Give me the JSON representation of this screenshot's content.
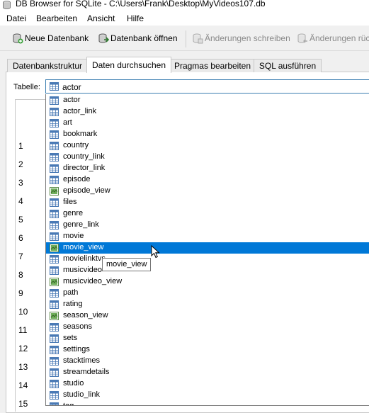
{
  "window": {
    "title": "DB Browser for SQLite - C:\\Users\\Frank\\Desktop\\MyVideos107.db"
  },
  "menu": [
    "Datei",
    "Bearbeiten",
    "Ansicht",
    "Hilfe"
  ],
  "toolbar": {
    "new_db": "Neue Datenbank",
    "open_db": "Datenbank öffnen",
    "write_changes": "Änderungen schreiben",
    "revert_changes": "Änderungen rück"
  },
  "tabs": [
    "Datenbankstruktur",
    "Daten durchsuchen",
    "Pragmas bearbeiten",
    "SQL ausführen"
  ],
  "active_tab": "Daten durchsuchen",
  "table_selector": {
    "label": "Tabelle:",
    "value": "actor"
  },
  "row_numbers": [
    "1",
    "2",
    "3",
    "4",
    "5",
    "6",
    "7",
    "8",
    "9",
    "10",
    "11",
    "12",
    "13",
    "14",
    "15"
  ],
  "dropdown": {
    "items": [
      {
        "name": "actor",
        "icon": "table-icon"
      },
      {
        "name": "actor_link",
        "icon": "table-icon"
      },
      {
        "name": "art",
        "icon": "table-icon"
      },
      {
        "name": "bookmark",
        "icon": "table-icon"
      },
      {
        "name": "country",
        "icon": "table-icon"
      },
      {
        "name": "country_link",
        "icon": "table-icon"
      },
      {
        "name": "director_link",
        "icon": "table-icon"
      },
      {
        "name": "episode",
        "icon": "table-icon"
      },
      {
        "name": "episode_view",
        "icon": "view-icon"
      },
      {
        "name": "files",
        "icon": "table-icon"
      },
      {
        "name": "genre",
        "icon": "table-icon"
      },
      {
        "name": "genre_link",
        "icon": "table-icon"
      },
      {
        "name": "movie",
        "icon": "table-icon"
      },
      {
        "name": "movie_view",
        "icon": "view-icon",
        "selected": true
      },
      {
        "name": "movielinktvs",
        "icon": "table-icon"
      },
      {
        "name": "musicvideo",
        "icon": "table-icon"
      },
      {
        "name": "musicvideo_view",
        "icon": "view-icon"
      },
      {
        "name": "path",
        "icon": "table-icon"
      },
      {
        "name": "rating",
        "icon": "table-icon"
      },
      {
        "name": "season_view",
        "icon": "view-icon"
      },
      {
        "name": "seasons",
        "icon": "table-icon"
      },
      {
        "name": "sets",
        "icon": "table-icon"
      },
      {
        "name": "settings",
        "icon": "table-icon"
      },
      {
        "name": "stacktimes",
        "icon": "table-icon"
      },
      {
        "name": "streamdetails",
        "icon": "table-icon"
      },
      {
        "name": "studio",
        "icon": "table-icon"
      },
      {
        "name": "studio_link",
        "icon": "table-icon"
      },
      {
        "name": "tag",
        "icon": "table-icon"
      }
    ]
  },
  "tooltip": "movie_view",
  "colors": {
    "selection": "#0078d7",
    "combo_border": "#3c7fb1"
  }
}
